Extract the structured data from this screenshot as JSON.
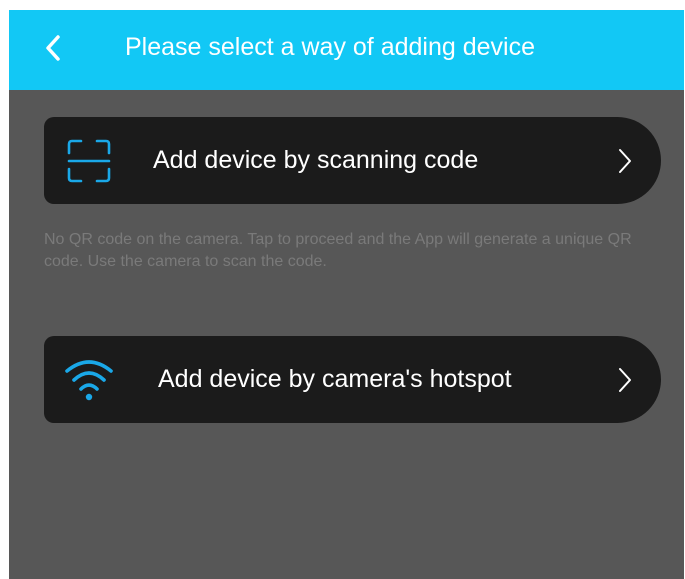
{
  "header": {
    "title": "Please select a way of adding device",
    "back_icon": "chevron-left-icon"
  },
  "options": [
    {
      "label": "Add device by scanning code",
      "icon": "scan-frame-icon",
      "chevron_icon": "chevron-right-icon"
    },
    {
      "label": "Add device by camera's hotspot",
      "icon": "wifi-icon",
      "chevron_icon": "chevron-right-icon"
    }
  ],
  "scan_help_text": "No QR code on the camera. Tap to proceed and the App will generate a unique QR code. Use the camera to scan the code.",
  "colors": {
    "header_background": "#12c8f5",
    "page_background": "#575757",
    "card_background": "#1b1b1b",
    "icon_accent": "#1aa8e8",
    "help_text": "#7a7a7a"
  }
}
